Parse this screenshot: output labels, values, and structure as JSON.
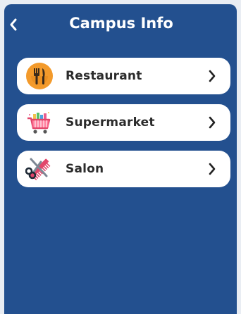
{
  "header": {
    "title": "Campus Info"
  },
  "items": [
    {
      "label": "Restaurant",
      "icon": "restaurant-icon"
    },
    {
      "label": "Supermarket",
      "icon": "shopping-cart-icon"
    },
    {
      "label": "Salon",
      "icon": "scissors-comb-icon"
    }
  ],
  "colors": {
    "background": "#23508f",
    "card": "#ffffff",
    "text": "#2b2b2b"
  }
}
